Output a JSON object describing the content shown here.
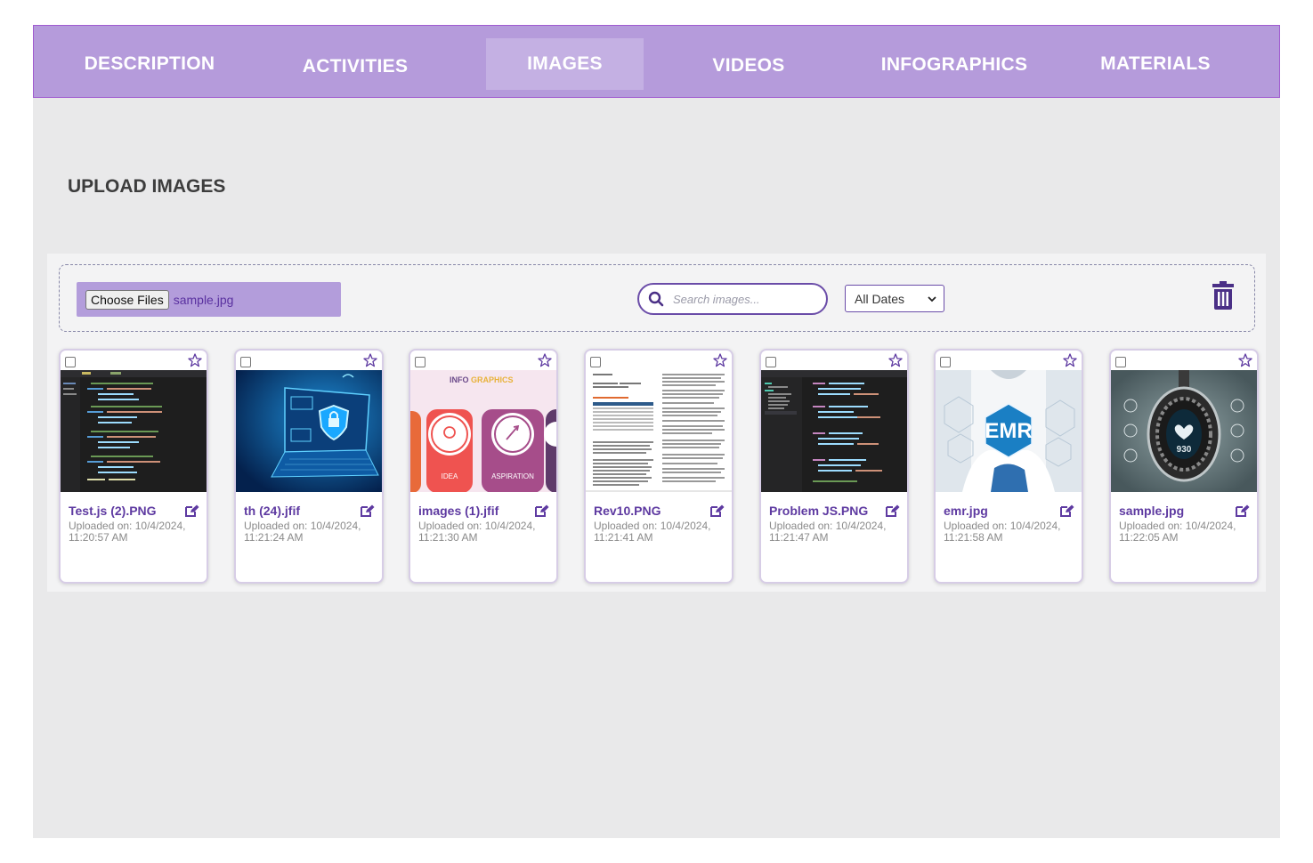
{
  "tabs": [
    {
      "label": "DESCRIPTION",
      "active": false
    },
    {
      "label": "ACTIVITIES",
      "active": false
    },
    {
      "label": "IMAGES",
      "active": true
    },
    {
      "label": "VIDEOS",
      "active": false
    },
    {
      "label": "INFOGRAPHICS",
      "active": false
    },
    {
      "label": "MATERIALS",
      "active": false
    }
  ],
  "section_title": "UPLOAD IMAGES",
  "toolbar": {
    "choose_files_label": "Choose Files",
    "selected_file": "sample.jpg",
    "search_placeholder": "Search images...",
    "date_filter_value": "All Dates"
  },
  "cards": [
    {
      "name": "Test.js (2).PNG",
      "uploaded_label": "Uploaded on:",
      "date": "10/4/2024,",
      "time": "11:20:57 AM",
      "thumb": "code-dark"
    },
    {
      "name": "th (24).jfif",
      "uploaded_label": "Uploaded on:",
      "date": "10/4/2024,",
      "time": "11:21:24 AM",
      "thumb": "laptop-shield"
    },
    {
      "name": "images (1).jfif",
      "uploaded_label": "Uploaded on:",
      "date": "10/4/2024,",
      "time": "11:21:30 AM",
      "thumb": "infographic",
      "thumb_text": {
        "title_a": "INFO",
        "title_b": "GRAPHICS",
        "label_1": "IDEA",
        "label_2": "ASPIRATION"
      }
    },
    {
      "name": "Rev10.PNG",
      "uploaded_label": "Uploaded on:",
      "date": "10/4/2024,",
      "time": "11:21:41 AM",
      "thumb": "document"
    },
    {
      "name": "Problem JS.PNG",
      "uploaded_label": "Uploaded on:",
      "date": "10/4/2024,",
      "time": "11:21:47 AM",
      "thumb": "code-tree"
    },
    {
      "name": "emr.jpg",
      "uploaded_label": "Uploaded on:",
      "date": "10/4/2024,",
      "time": "11:21:58 AM",
      "thumb": "emr",
      "thumb_text": {
        "badge": "EMR"
      }
    },
    {
      "name": "sample.jpg",
      "uploaded_label": "Uploaded on:",
      "date": "10/4/2024,",
      "time": "11:22:05 AM",
      "thumb": "watch",
      "thumb_text": {
        "value": "930"
      }
    }
  ],
  "colors": {
    "tab_bar": "#b59bdb",
    "tab_active": "#c4b0e3",
    "accent": "#5e3aa1",
    "page_bg": "#e9e9ea"
  },
  "icons": [
    "search-icon",
    "chevron-down-icon",
    "trash-icon",
    "star-icon",
    "edit-icon",
    "checkbox-icon"
  ]
}
